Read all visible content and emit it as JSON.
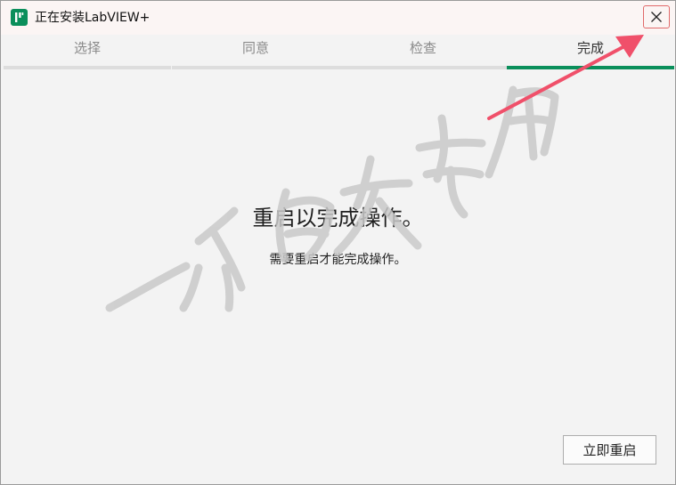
{
  "window": {
    "title": "正在安装LabVIEW+"
  },
  "tabs": [
    {
      "label": "选择",
      "active": false
    },
    {
      "label": "同意",
      "active": false
    },
    {
      "label": "检查",
      "active": false
    },
    {
      "label": "完成",
      "active": true
    }
  ],
  "content": {
    "heading": "重启以完成操作。",
    "message": "需要重启才能完成操作。",
    "restart_button": "立即重启"
  },
  "colors": {
    "accent": "#0a8f5b",
    "close_highlight": "#e06a6a",
    "annotation_arrow": "#f0506a"
  },
  "icons": {
    "app": "labview-app-icon",
    "close": "close-icon",
    "annotation": "annotation-arrow"
  }
}
